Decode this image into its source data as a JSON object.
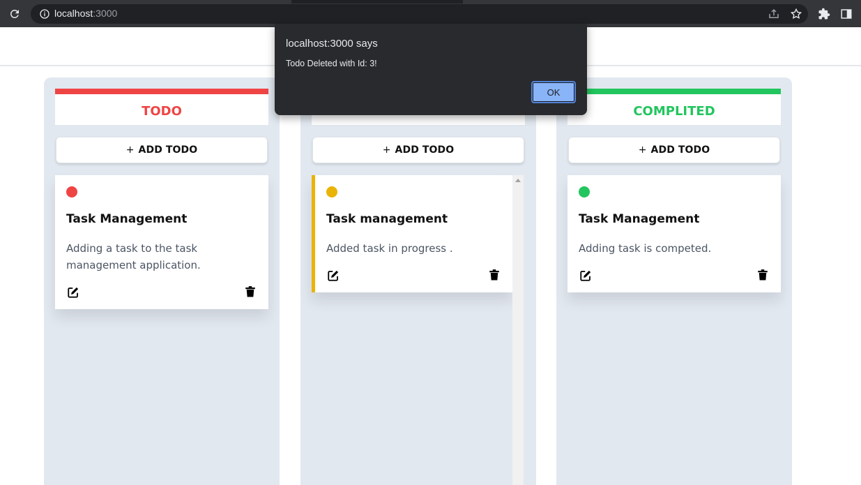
{
  "browser": {
    "url_host": "localhost",
    "url_port": ":3000",
    "icons": [
      "reload-icon",
      "info-icon",
      "share-icon",
      "star-icon",
      "extensions-icon",
      "side-panel-icon"
    ]
  },
  "dialog": {
    "title": "localhost:3000 says",
    "message": "Todo Deleted with Id: 3!",
    "ok_label": "OK"
  },
  "columns": [
    {
      "title": "TODO",
      "color": "#ef4444",
      "add_label": "ADD TODO",
      "add_prefix": "+",
      "card": {
        "title": "Task Management",
        "description": "Adding a task to the task management application."
      }
    },
    {
      "title": "",
      "color": "#eab308",
      "add_label": "ADD TODO",
      "add_prefix": "+",
      "card": {
        "title": "Task management",
        "description": "Added task in progress ."
      }
    },
    {
      "title": "COMPLITED",
      "color": "#22c55e",
      "add_label": "ADD TODO",
      "add_prefix": "+",
      "card": {
        "title": "Task Management",
        "description": "Adding task is competed."
      }
    }
  ]
}
